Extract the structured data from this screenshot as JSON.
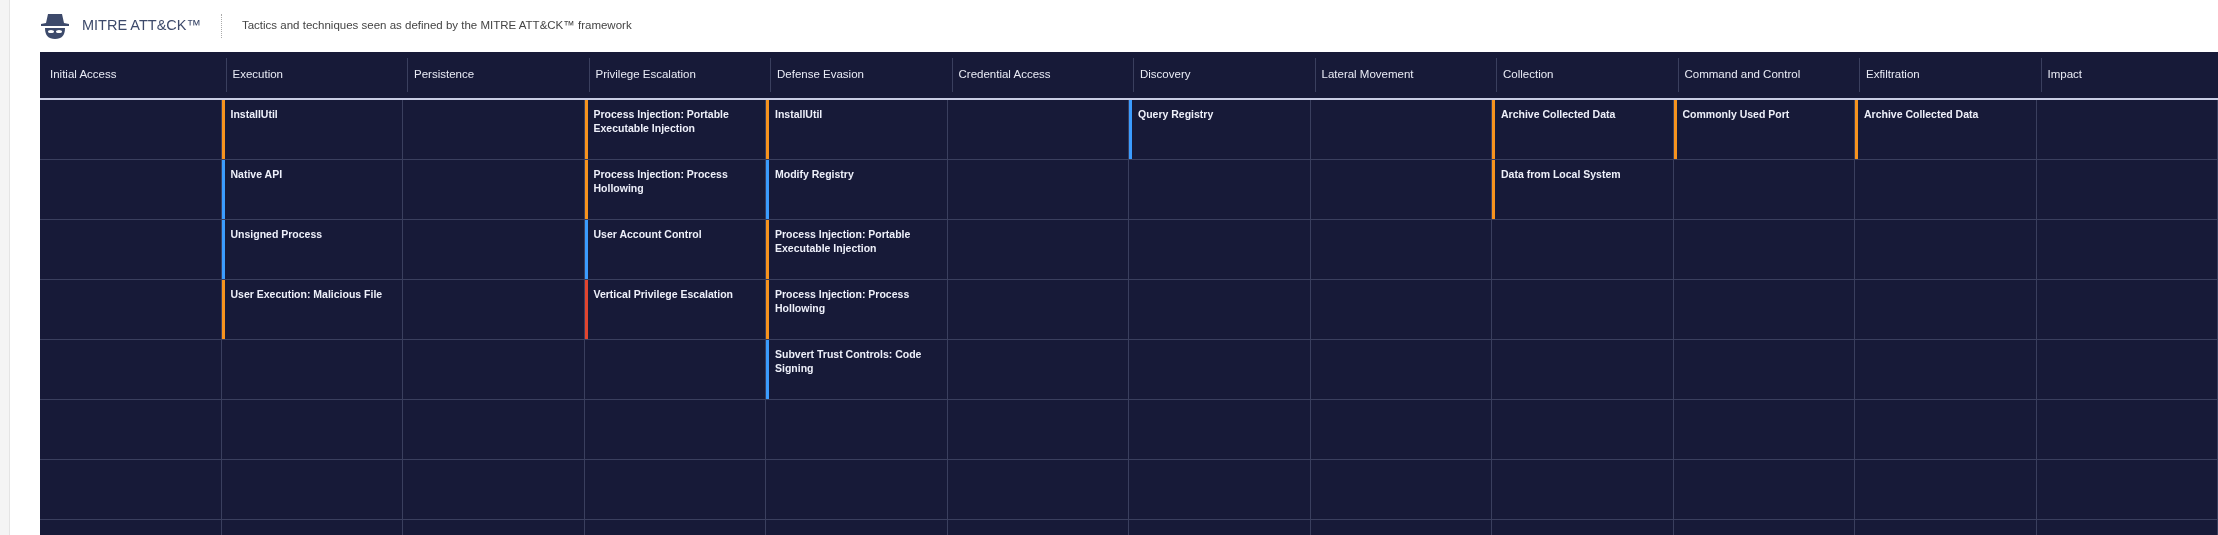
{
  "header": {
    "title": "MITRE ATT&CK™",
    "subtitle": "Tactics and techniques seen as defined by the MITRE ATT&CK™ framework"
  },
  "tactics": [
    {
      "name": "Initial Access"
    },
    {
      "name": "Execution",
      "techniques": [
        {
          "name": "InstallUtil",
          "color": "#f7931e"
        },
        {
          "name": "Native API",
          "color": "#3b9cff"
        },
        {
          "name": "Unsigned Process",
          "color": "#3b9cff"
        },
        {
          "name": "User Execution: Malicious File",
          "color": "#f7931e"
        }
      ]
    },
    {
      "name": "Persistence"
    },
    {
      "name": "Privilege Escalation",
      "techniques": [
        {
          "name": "Process Injection: Portable Executable Injection",
          "color": "#f7931e"
        },
        {
          "name": "Process Injection: Process Hollowing",
          "color": "#f7931e"
        },
        {
          "name": "User Account Control",
          "color": "#3b9cff"
        },
        {
          "name": "Vertical Privilege Escalation",
          "color": "#e0452f"
        }
      ]
    },
    {
      "name": "Defense Evasion",
      "techniques": [
        {
          "name": "InstallUtil",
          "color": "#f7931e"
        },
        {
          "name": "Modify Registry",
          "color": "#3b9cff"
        },
        {
          "name": "Process Injection: Portable Executable Injection",
          "color": "#f7931e"
        },
        {
          "name": "Process Injection: Process Hollowing",
          "color": "#f7931e"
        },
        {
          "name": "Subvert Trust Controls: Code Signing",
          "color": "#3b9cff"
        }
      ]
    },
    {
      "name": "Credential Access"
    },
    {
      "name": "Discovery",
      "techniques": [
        {
          "name": "Query Registry",
          "color": "#3b9cff"
        }
      ]
    },
    {
      "name": "Lateral Movement"
    },
    {
      "name": "Collection",
      "techniques": [
        {
          "name": "Archive Collected Data",
          "color": "#f7931e"
        },
        {
          "name": "Data from Local System",
          "color": "#f7931e"
        }
      ]
    },
    {
      "name": "Command and Control",
      "techniques": [
        {
          "name": "Commonly Used Port",
          "color": "#f7931e"
        }
      ]
    },
    {
      "name": "Exfiltration",
      "techniques": [
        {
          "name": "Archive Collected Data",
          "color": "#f7931e"
        }
      ]
    },
    {
      "name": "Impact"
    }
  ]
}
